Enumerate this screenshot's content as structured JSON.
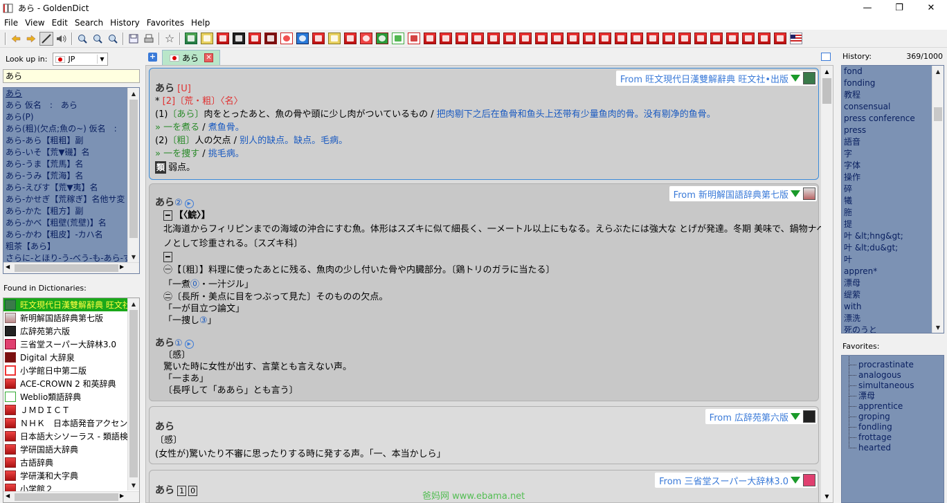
{
  "window": {
    "title": "あら - GoldenDict",
    "controls": [
      "—",
      "❐",
      "✕"
    ]
  },
  "menu": [
    "File",
    "View",
    "Edit",
    "Search",
    "History",
    "Favorites",
    "Help"
  ],
  "lookup": {
    "label": "Look up in:",
    "group": "JP",
    "query": "あら"
  },
  "wordlist": [
    "あら",
    "あら 仮名　:　あら",
    "あら(P)",
    "あら(粗)(欠点;魚の~) 仮名　:",
    "あら-あら【粗粗】副",
    "あら-いそ【荒▼磯】名",
    "あら-うま【荒馬】名",
    "あら-うみ【荒海】名",
    "あら-えびす【荒▼夷】名",
    "あら-かせぎ【荒稼ぎ】名他サ変",
    "あら-かた【粗方】副",
    "あら-かべ【粗壁(荒壁)】名",
    "あら-かわ【粗皮】-カハ名",
    "粗茶【あら】",
    "さらに-とほり-う-べう-も-あら-ず"
  ],
  "found_label": "Found in Dictionaries:",
  "dictionaries": [
    "旺文現代日漢雙解辭典 旺文社",
    "新明解国語辞典第七版",
    "広辞苑第六版",
    "三省堂スーパー大辞林3.0",
    "Digital 大辞泉",
    "小学館日中第二版",
    "ACE-CROWN 2 和英辞典",
    "Weblio類語辞典",
    "ＪＭＤＩＣＴ",
    "ＮＨＫ　日本語発音アクセント",
    "日本語大シソーラス - 類語検索",
    "学研国語大辞典",
    "古語辞典",
    "学研漢和大字典",
    "小学館２"
  ],
  "tab": {
    "label": "あら",
    "close": "✕",
    "new": "+"
  },
  "articles": {
    "a1": {
      "from": "From 旺文現代日漢雙解辭典 旺文社•出版",
      "head": "あら",
      "head_tag": "[U]",
      "l2_star": "*",
      "l2_num": "[2]",
      "l2_kanji": "〔荒・粗〕",
      "l2_pos": "〈名〉",
      "s1_num": "(1)",
      "s1_kw": "〔あら〕",
      "s1_jp": "肉をとったあと、魚の骨や頭に少し肉がついているもの",
      "s1_sep": " / ",
      "s1_cn": "把肉剔下之后在鱼骨和鱼头上还带有少量鱼肉的骨。没有剔净的鱼骨。",
      "e1_jp": "» 一を煮る",
      "e1_sep": " / ",
      "e1_cn": "煮鱼骨。",
      "s2_num": "(2)",
      "s2_kw": "〔粗〕",
      "s2_jp": "人の欠点",
      "s2_sep": " / ",
      "s2_cn": "别人的缺点。缺点。毛病。",
      "e2_jp": "» 一を捜す",
      "e2_sep": " / ",
      "e2_cn": "挑毛病。",
      "syn_tag": "類",
      "syn": "弱点。"
    },
    "a2": {
      "from": "From 新明解国語辞典第七版",
      "head": "あら",
      "head_num": "②",
      "m1_tag": "━",
      "m1": "【〈鯇〉】",
      "m1_def": "北海道からフィリピンまでの海域の沖合にすむ魚。体形はスズキに似て細長く、一メートル以上にもなる。えらぶたには強大な とげが発達。冬期 美味で、鍋物ナベモ",
      "m1_def2": "ノとして珍重される。〔スズキ科〕",
      "m2_tag": "━",
      "m2_1": "㊀【〔粗〕】料理に使ったあとに残る、魚肉の少し付いた骨や内臓部分。〔鶏トリのガラに当たる〕",
      "m2_ex1": "「一煮",
      "m2_ex1_num": "⓪",
      "m2_ex1_b": "・一汁ジル」",
      "m2_2": "㊁〔長所・美点に目をつぶって見た〕そのものの欠点。",
      "m2_ex2": "「一が目立つ論文」",
      "m2_ex3": "「一捜し",
      "m2_ex3_num": "③",
      "m2_ex3_b": "」",
      "head2": "あら",
      "head2_num": "①",
      "h2_pos": "〔感〕",
      "h2_def": "驚いた時に女性が出す、言葉とも言えない声。",
      "h2_ex": "「一まあ」",
      "h2_note": "〔長呼して「ああら」とも言う〕"
    },
    "a3": {
      "from": "From 広辞苑第六版",
      "head": "あら",
      "pos": "〔感〕",
      "def": "(女性が)驚いたり不審に思ったりする時に発する声。「一、本当かしら」"
    },
    "a4": {
      "from": "From 三省堂スーパー大辞林3.0",
      "head": "あら",
      "n1": "1",
      "n2": "0"
    }
  },
  "history": {
    "label": "History:",
    "count": "369/1000",
    "items": [
      "fond",
      "fonding",
      "教程",
      "consensual",
      "press conference",
      "press",
      "語音",
      "字",
      "字体",
      "操作",
      "碎",
      "犧",
      "胣",
      "提",
      "叶 &lt;hng&gt;",
      "叶 &lt;du&gt;",
      "叶",
      "appren*",
      "漂母",
      "缇萦",
      "with",
      "漂洗",
      "死のうと"
    ]
  },
  "favorites": {
    "label": "Favorites:",
    "items": [
      "procrastinate",
      "analogous",
      "simultaneous",
      "漂母",
      "apprentice",
      "groping",
      "fondling",
      "frottage",
      "hearted"
    ]
  },
  "watermark": "爸妈网 www.ebama.net"
}
